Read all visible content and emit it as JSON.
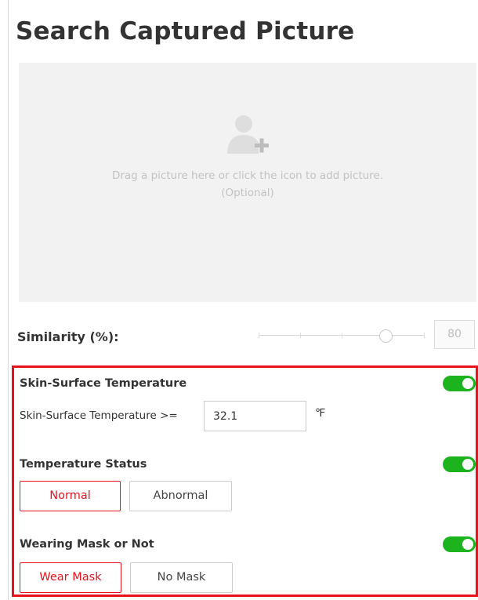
{
  "page": {
    "title": "Search Captured Picture"
  },
  "upload": {
    "icon": "add-person-icon",
    "hint_line1": "Drag a picture here or click the icon to add picture.",
    "hint_line2": "(Optional)"
  },
  "similarity": {
    "label": "Similarity (%):",
    "value": "80",
    "slider_value": 80
  },
  "skin_temperature": {
    "label": "Skin-Surface Temperature",
    "enabled": true,
    "condition_label": "Skin-Surface Temperature >=",
    "threshold": "32.1",
    "unit": "℉"
  },
  "temperature_status": {
    "label": "Temperature Status",
    "enabled": true,
    "options": [
      "Normal",
      "Abnormal"
    ],
    "selected": "Normal"
  },
  "mask": {
    "label": "Wearing Mask or Not",
    "enabled": true,
    "options": [
      "Wear Mask",
      "No Mask"
    ],
    "selected": "Wear Mask"
  },
  "colors": {
    "accent_red": "#e8111c",
    "toggle_green": "#1db31f"
  }
}
